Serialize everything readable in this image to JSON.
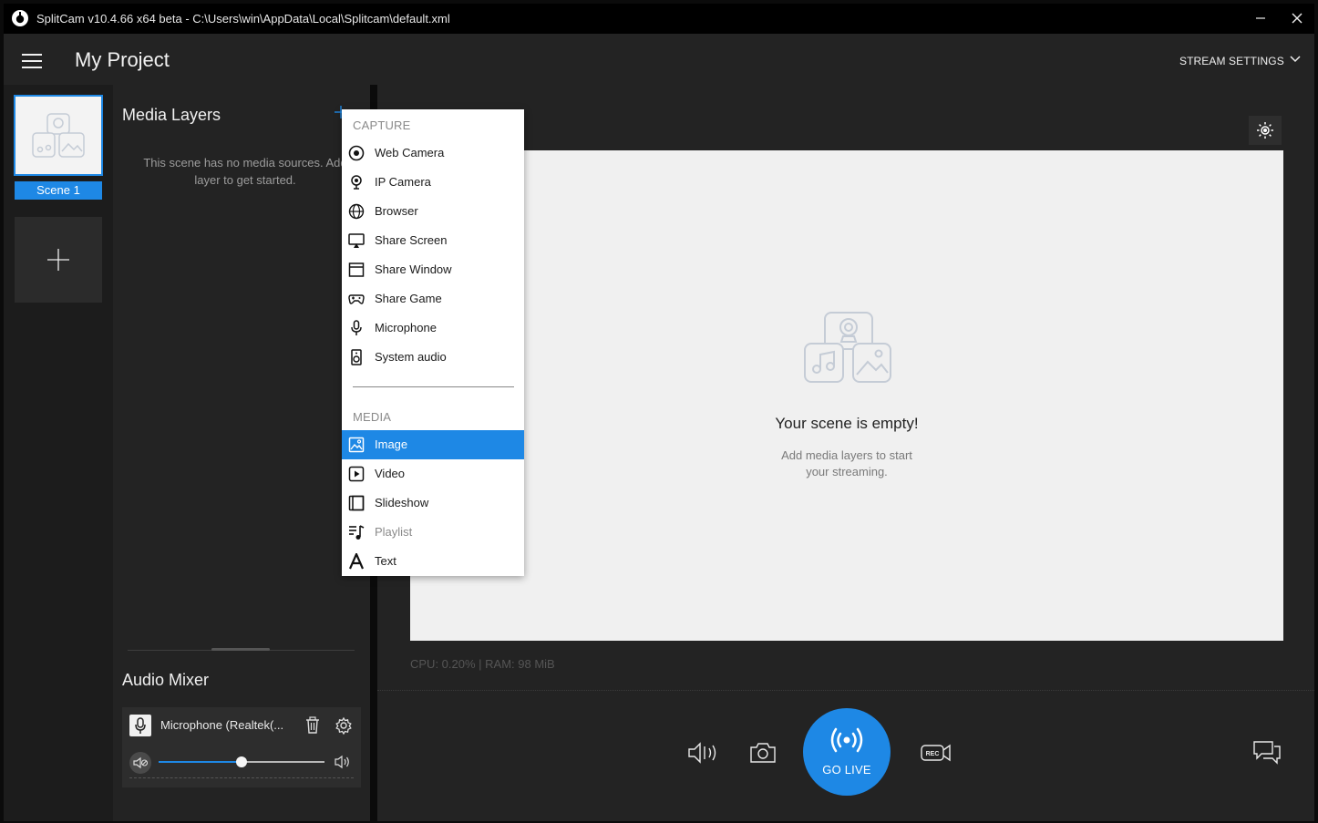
{
  "window": {
    "title": "SplitCam v10.4.66 x64 beta - C:\\Users\\win\\AppData\\Local\\Splitcam\\default.xml",
    "minimize_glyph": "—",
    "close_glyph": "✕"
  },
  "header": {
    "project_title": "My Project",
    "stream_settings_label": "STREAM SETTINGS"
  },
  "scenes": {
    "items": [
      {
        "label": "Scene 1",
        "selected": true
      }
    ],
    "add_icon": "plus-icon"
  },
  "media_layers": {
    "title": "Media Layers",
    "empty_text": "This scene has no media sources. Add layer to get started.",
    "empty_line1": "This scene has no media sources. Add",
    "empty_line2": "layer to get started."
  },
  "add_menu": {
    "capture_header": "CAPTURE",
    "capture_items": [
      {
        "label": "Web Camera",
        "icon": "webcam-icon"
      },
      {
        "label": "IP Camera",
        "icon": "ip-camera-icon"
      },
      {
        "label": "Browser",
        "icon": "globe-icon"
      },
      {
        "label": "Share Screen",
        "icon": "share-screen-icon"
      },
      {
        "label": "Share Window",
        "icon": "window-icon"
      },
      {
        "label": "Share Game",
        "icon": "gamepad-icon"
      },
      {
        "label": "Microphone",
        "icon": "microphone-icon"
      },
      {
        "label": "System audio",
        "icon": "speaker-icon"
      }
    ],
    "media_header": "MEDIA",
    "media_items": [
      {
        "label": "Image",
        "icon": "image-icon",
        "selected": true
      },
      {
        "label": "Video",
        "icon": "video-icon"
      },
      {
        "label": "Slideshow",
        "icon": "slideshow-icon"
      },
      {
        "label": "Playlist",
        "icon": "playlist-icon",
        "disabled": true
      },
      {
        "label": "Text",
        "icon": "text-icon"
      }
    ]
  },
  "audio_mixer": {
    "title": "Audio Mixer",
    "device_name": "Microphone  (Realtek(...",
    "volume_fraction": 0.5
  },
  "preview": {
    "empty_title": "Your scene is empty!",
    "empty_subtitle_line1": "Add media layers to start",
    "empty_subtitle_line2": "your streaming.",
    "stats": "CPU: 0.20% | RAM: 98 MiB"
  },
  "toolbar": {
    "go_live_label": "GO LIVE",
    "rec_badge": "REC"
  },
  "colors": {
    "accent": "#1e88e5",
    "background": "#232323",
    "titlebar": "#000000"
  }
}
